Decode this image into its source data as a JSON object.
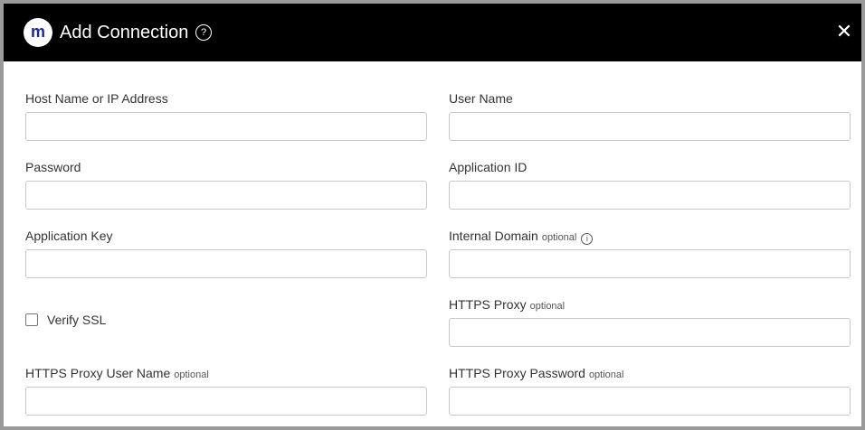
{
  "dialog": {
    "logo_letter": "m",
    "title": "Add Connection",
    "help_symbol": "?",
    "close_symbol": "✕"
  },
  "form": {
    "host": {
      "label": "Host Name or IP Address",
      "value": ""
    },
    "username": {
      "label": "User Name",
      "value": ""
    },
    "password": {
      "label": "Password",
      "value": ""
    },
    "app_id": {
      "label": "Application ID",
      "value": ""
    },
    "app_key": {
      "label": "Application Key",
      "value": ""
    },
    "internal_domain": {
      "label": "Internal Domain",
      "optional": "optional",
      "info_symbol": "i",
      "value": ""
    },
    "verify_ssl": {
      "label": "Verify SSL",
      "checked": false
    },
    "https_proxy": {
      "label": "HTTPS Proxy",
      "optional": "optional",
      "value": ""
    },
    "proxy_user": {
      "label": "HTTPS Proxy User Name",
      "optional": "optional",
      "value": ""
    },
    "proxy_password": {
      "label": "HTTPS Proxy Password",
      "optional": "optional",
      "value": ""
    }
  }
}
